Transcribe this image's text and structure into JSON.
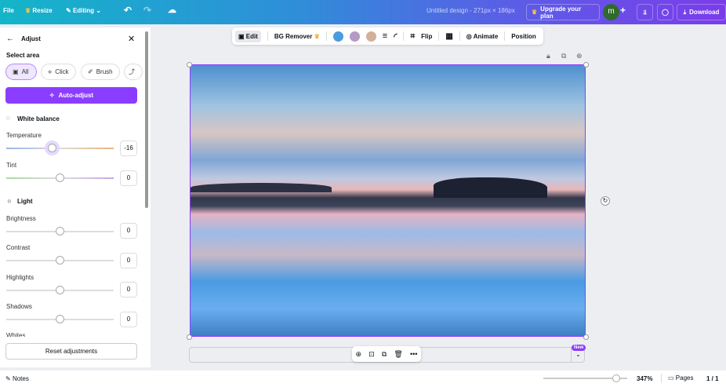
{
  "topbar": {
    "file": "File",
    "resize": "Resize",
    "editing": "Editing",
    "doc_title": "Untitled design - 271px × 186px",
    "upgrade": "Upgrade your plan",
    "avatar": "m",
    "download": "Download"
  },
  "panel": {
    "title": "Adjust",
    "select_area": "Select area",
    "areas": [
      "All",
      "Click",
      "Brush"
    ],
    "auto_adjust": "Auto-adjust",
    "white_balance": "White balance",
    "temperature": {
      "label": "Temperature",
      "value": "-16",
      "fraction": 0.43
    },
    "tint": {
      "label": "Tint",
      "value": "0",
      "fraction": 0.5
    },
    "light": "Light",
    "brightness": {
      "label": "Brightness",
      "value": "0",
      "fraction": 0.5
    },
    "contrast": {
      "label": "Contrast",
      "value": "0",
      "fraction": 0.5
    },
    "highlights": {
      "label": "Highlights",
      "value": "0",
      "fraction": 0.5
    },
    "shadows": {
      "label": "Shadows",
      "value": "0",
      "fraction": 0.5
    },
    "whites": "Whites",
    "reset": "Reset adjustments"
  },
  "toolbar": {
    "edit": "Edit",
    "bg_remover": "BG Remover",
    "colors": [
      "#4a9be0",
      "#b49ac4",
      "#d2b09a"
    ],
    "flip": "Flip",
    "animate": "Animate",
    "position": "Position"
  },
  "canvas": {
    "new_badge": "New"
  },
  "footer": {
    "notes": "Notes",
    "zoom": "347%",
    "pages": "Pages",
    "page_count": "1 / 1",
    "zoom_fraction": 0.87
  }
}
